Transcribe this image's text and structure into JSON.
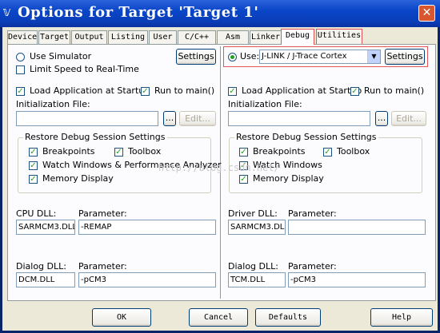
{
  "window": {
    "title": "Options for Target 'Target 1'",
    "app_icon": "uv-icon"
  },
  "tabs": [
    "Device",
    "Target",
    "Output",
    "Listing",
    "User",
    "C/C++",
    "Asm",
    "Linker",
    "Debug",
    "Utilities"
  ],
  "active_tab": "Debug",
  "left": {
    "use_simulator": "Use Simulator",
    "limit_speed": "Limit Speed to Real-Time",
    "settings": "Settings",
    "load_app": "Load Application at Startup",
    "run_to_main": "Run to main()",
    "init_file": "Initialization File:",
    "browse": "...",
    "edit": "Edit...",
    "restore_group": "Restore Debug Session Settings",
    "breakpoints": "Breakpoints",
    "toolbox": "Toolbox",
    "watch": "Watch Windows & Performance Analyzer",
    "memory": "Memory Display",
    "dll_label": "CPU DLL:",
    "param_label": "Parameter:",
    "dll_value": "SARMCM3.DLL",
    "param_value": "-REMAP",
    "dialog_dll_label": "Dialog DLL:",
    "dialog_param_label": "Parameter:",
    "dialog_dll_value": "DCM.DLL",
    "dialog_param_value": "-pCM3"
  },
  "right": {
    "use": "Use:",
    "driver": "J-LINK / J-Trace Cortex",
    "settings": "Settings",
    "load_app": "Load Application at Startup",
    "run_to_main": "Run to main()",
    "init_file": "Initialization File:",
    "browse": "...",
    "edit": "Edit...",
    "restore_group": "Restore Debug Session Settings",
    "breakpoints": "Breakpoints",
    "toolbox": "Toolbox",
    "watch": "Watch Windows",
    "memory": "Memory Display",
    "dll_label": "Driver DLL:",
    "param_label": "Parameter:",
    "dll_value": "SARMCM3.DLL",
    "param_value": "",
    "dialog_dll_label": "Dialog DLL:",
    "dialog_param_label": "Parameter:",
    "dialog_dll_value": "TCM.DLL",
    "dialog_param_value": "-pCM3"
  },
  "watermark": "http://blog.csdn.net/",
  "buttons": {
    "ok": "OK",
    "cancel": "Cancel",
    "defaults": "Defaults",
    "help": "Help"
  },
  "colors": {
    "titlebar": "#0a46c8",
    "highlight": "#e05555",
    "check": "#21a121"
  }
}
